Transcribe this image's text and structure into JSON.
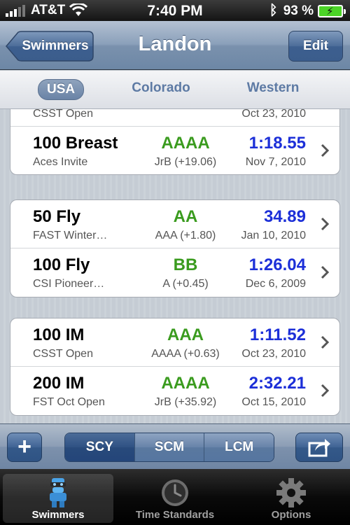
{
  "status": {
    "carrier": "AT&T",
    "time": "7:40 PM",
    "battery": "93 %"
  },
  "nav": {
    "back_label": "Swimmers",
    "title": "Landon",
    "edit_label": "Edit"
  },
  "scope": {
    "items": [
      "USA",
      "Colorado",
      "Western"
    ],
    "selected": "USA"
  },
  "groups": [
    {
      "rows": [
        {
          "event": "",
          "meet": "CSST Open",
          "standard": "",
          "diff": "",
          "time": "",
          "date": "Oct 23, 2010"
        },
        {
          "event": "100 Breast",
          "meet": "Aces Invite",
          "standard": "AAAA",
          "diff": "JrB (+19.06)",
          "time": "1:18.55",
          "date": "Nov 7, 2010"
        }
      ]
    },
    {
      "rows": [
        {
          "event": "50 Fly",
          "meet": "FAST Winter…",
          "standard": "AA",
          "diff": "AAA (+1.80)",
          "time": "34.89",
          "date": "Jan 10, 2010"
        },
        {
          "event": "100 Fly",
          "meet": "CSI Pioneer…",
          "standard": "BB",
          "diff": "A (+0.45)",
          "time": "1:26.04",
          "date": "Dec 6, 2009"
        }
      ]
    },
    {
      "rows": [
        {
          "event": "100 IM",
          "meet": "CSST Open",
          "standard": "AAA",
          "diff": "AAAA (+0.63)",
          "time": "1:11.52",
          "date": "Oct 23, 2010"
        },
        {
          "event": "200 IM",
          "meet": "FST Oct Open",
          "standard": "AAAA",
          "diff": "JrB (+35.92)",
          "time": "2:32.21",
          "date": "Oct 15, 2010"
        }
      ]
    }
  ],
  "toolbar": {
    "add_label": "+",
    "courses": [
      "SCY",
      "SCM",
      "LCM"
    ],
    "selected_course": "SCY"
  },
  "tabs": [
    {
      "label": "Swimmers",
      "icon": "swimmer-icon"
    },
    {
      "label": "Time Standards",
      "icon": "clock-icon"
    },
    {
      "label": "Options",
      "icon": "gear-icon"
    }
  ],
  "colors": {
    "standard_green": "#3a9b1e",
    "time_blue": "#1c2fd8"
  }
}
